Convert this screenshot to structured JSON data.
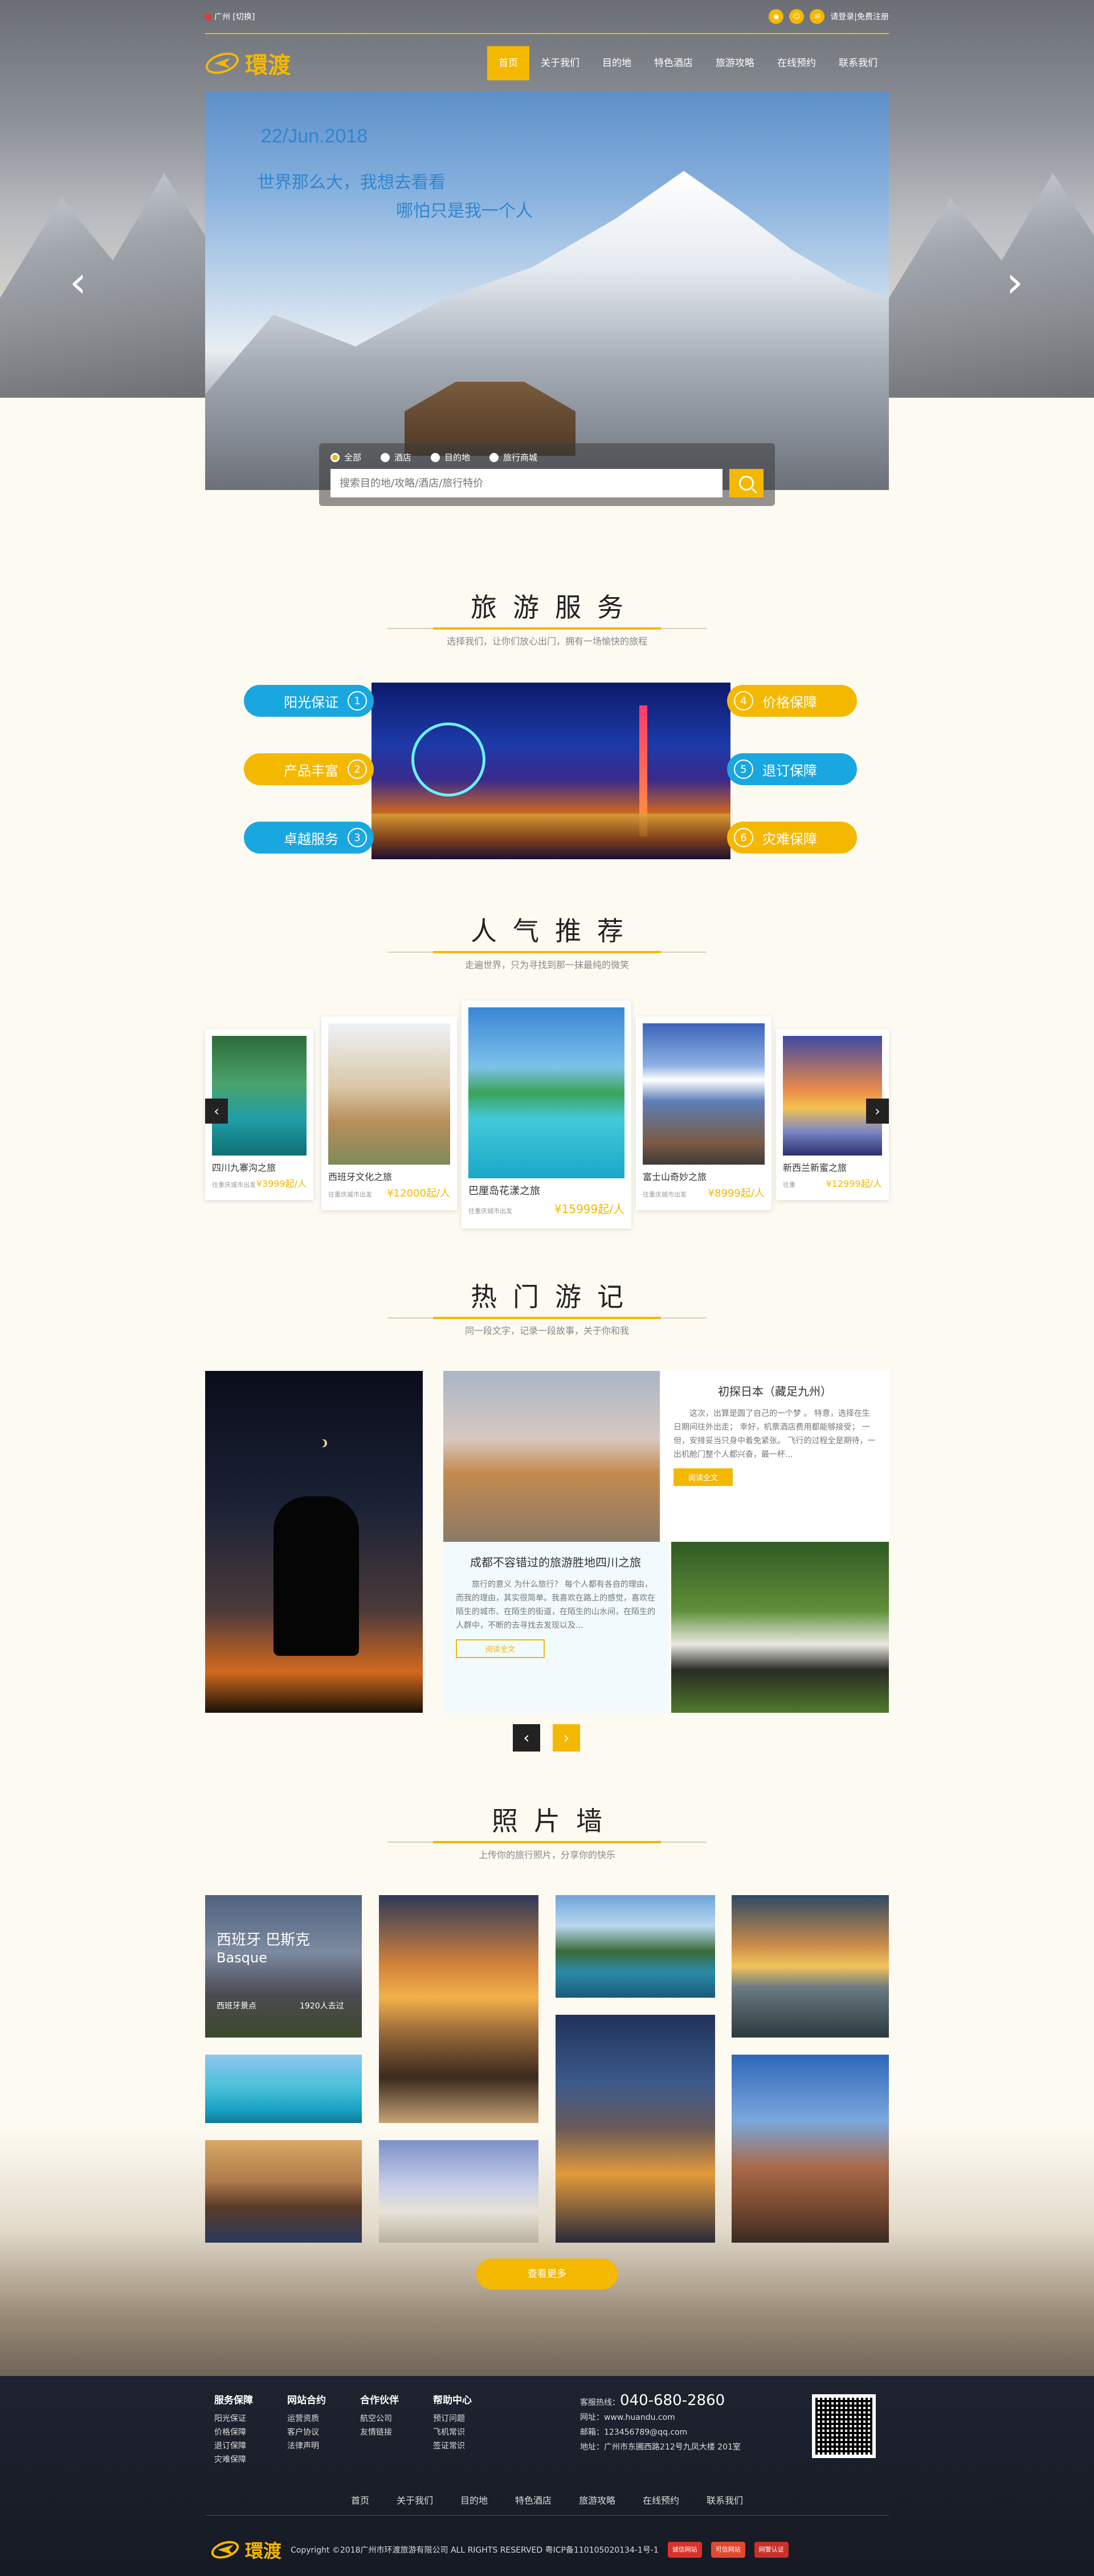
{
  "topbar": {
    "location": "广州 [切换]",
    "login": "请登录|免费注册"
  },
  "brand": {
    "name": "環渡"
  },
  "nav": [
    "首页",
    "关于我们",
    "目的地",
    "特色酒店",
    "旅游攻略",
    "在线预约",
    "联系我们"
  ],
  "hero": {
    "date": "22/Jun.2018",
    "slogan_line1": "世界那么大，我想去看看",
    "slogan_line2": "哪怕只是我一个人",
    "prev": "‹",
    "next": "›"
  },
  "search": {
    "options": [
      "全部",
      "酒店",
      "目的地",
      "旅行商城"
    ],
    "selected": "全部",
    "placeholder": "搜索目的地/攻略/酒店/旅行特价"
  },
  "services": {
    "title": "旅游服务",
    "subtitle": "选择我们，让你们放心出门，拥有一场愉快的旅程",
    "items": [
      {
        "num": "1",
        "label": "阳光保证"
      },
      {
        "num": "2",
        "label": "产品丰富"
      },
      {
        "num": "3",
        "label": "卓越服务"
      },
      {
        "num": "4",
        "label": "价格保障"
      },
      {
        "num": "5",
        "label": "退订保障"
      },
      {
        "num": "6",
        "label": "灾难保障"
      }
    ]
  },
  "recommend": {
    "title": "人气推荐",
    "subtitle": "走遍世界，只为寻找到那一抹最纯的微笑",
    "cards": [
      {
        "title": "四川九寨沟之旅",
        "sub": "往重庆城市出发",
        "price": "¥3999起/人"
      },
      {
        "title": "西班牙文化之旅",
        "sub": "往重庆城市出发",
        "price": "¥12000起/人"
      },
      {
        "title": "巴厘岛花漾之旅",
        "sub": "往重庆城市出发",
        "price": "¥15999起/人"
      },
      {
        "title": "富士山奇妙之旅",
        "sub": "往重庆城市出发",
        "price": "¥8999起/人"
      },
      {
        "title": "新西兰新蜜之旅",
        "sub": "往重",
        "price": "¥12999起/人"
      }
    ]
  },
  "notes": {
    "title": "热门游记",
    "subtitle": "同一段文字，记录一段故事，关于你和我",
    "items": [
      {
        "title": "初探日本（藏足九州）",
        "text": "这次，出算是圆了自己的一个梦 。 特意，选择在生日期间往外出走；  幸好，机票酒店费用都能够接受；  一但，安排妥当只身中着免紧张。  飞行的过程全是期待，一出机舱门整个人都兴奋，最一杯...",
        "button": "阅读全文"
      },
      {
        "title": "成都不容错过的旅游胜地四川之旅",
        "text": "旅行的意义 为什么旅行？ 每个人都有各自的理由，而我的理由，其实很简单。我喜欢在路上的感觉，喜欢在陌生的城市、在陌生的街道，在陌生的山水间，在陌生的人群中，不断的去寻找去发现以及...",
        "button": "阅读全文"
      }
    ],
    "prev": "‹",
    "next": "›"
  },
  "photos": {
    "title": "照片墙",
    "subtitle": "上传你的旅行照片，分享你的快乐",
    "featured": {
      "line1": "西班牙 巴斯克",
      "line2": "Basque",
      "tag": "西班牙景点",
      "count": "1920人去过"
    },
    "more": "查看更多"
  },
  "footer": {
    "cols": [
      {
        "title": "服务保障",
        "items": [
          "阳光保证",
          "价格保障",
          "退订保障",
          "灾难保障"
        ]
      },
      {
        "title": "网站合约",
        "items": [
          "运营资质",
          "客户协议",
          "法律声明"
        ]
      },
      {
        "title": "合作伙伴",
        "items": [
          "航空公司",
          "友情链接"
        ]
      },
      {
        "title": "帮助中心",
        "items": [
          "预订问题",
          "飞机常识",
          "签证常识"
        ]
      }
    ],
    "hotline_label": "客服热线：",
    "hotline": "040-680-2860",
    "site": "网址：www.huandu.com",
    "email": "邮箱：123456789@qq.com",
    "address": "地址：广州市东圃西路212号九凤大楼 201室",
    "nav": [
      "首页",
      "关于我们",
      "目的地",
      "特色酒店",
      "旅游攻略",
      "在线预约",
      "联系我们"
    ],
    "copyright": "Copyright ©2018广州市环渡旅游有限公司 ALL RIGHTS RESERVED 粤ICP备110105020134-1号-1",
    "badges": [
      "诚信网站",
      "可信网站",
      "网警认证"
    ]
  },
  "colors": {
    "accent": "#f5b800",
    "blue": "#19a7e0",
    "footer": "#1f2330"
  }
}
